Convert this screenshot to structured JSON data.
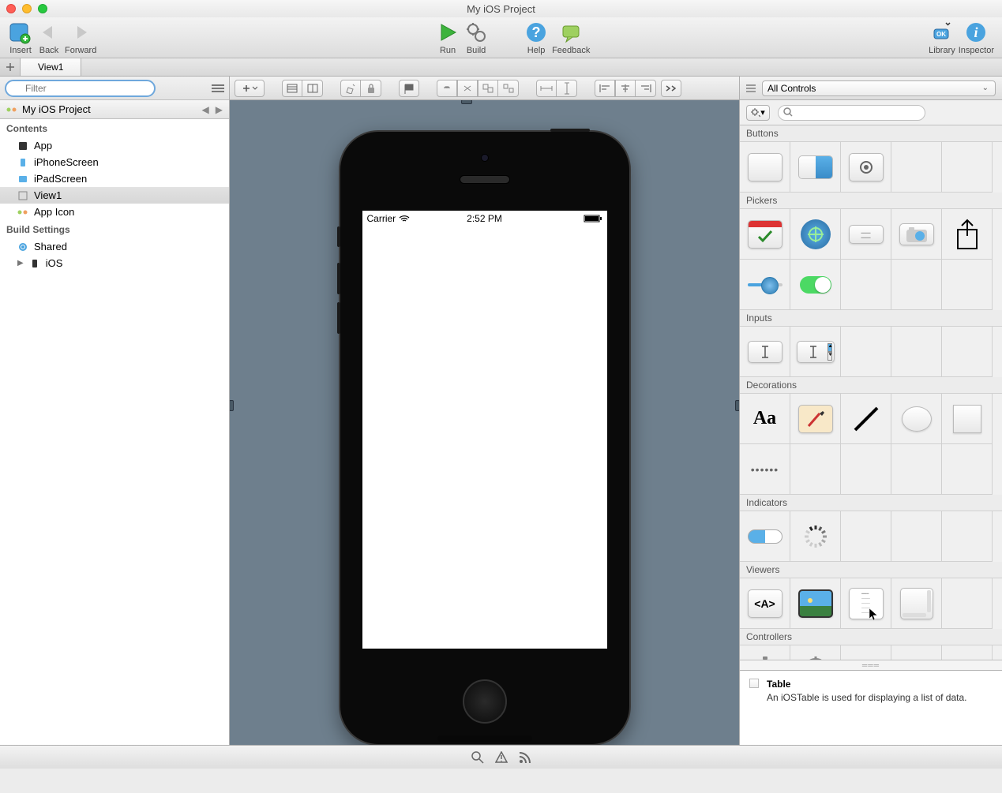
{
  "window": {
    "title": "My iOS Project"
  },
  "toolbar": {
    "insert": "Insert",
    "back": "Back",
    "forward": "Forward",
    "run": "Run",
    "build": "Build",
    "help": "Help",
    "feedback": "Feedback",
    "library": "Library",
    "inspector": "Inspector"
  },
  "tabs": [
    {
      "label": "View1"
    }
  ],
  "filter": {
    "placeholder": "Filter"
  },
  "project": {
    "name": "My iOS Project"
  },
  "contents": {
    "header": "Contents",
    "items": [
      {
        "label": "App"
      },
      {
        "label": "iPhoneScreen"
      },
      {
        "label": "iPadScreen"
      },
      {
        "label": "View1"
      },
      {
        "label": "App Icon"
      }
    ]
  },
  "buildSettings": {
    "header": "Build Settings",
    "items": [
      {
        "label": "Shared"
      },
      {
        "label": "iOS"
      }
    ]
  },
  "statusBar": {
    "carrier": "Carrier",
    "time": "2:52 PM"
  },
  "library": {
    "selectLabel": "All Controls",
    "sections": {
      "buttons": "Buttons",
      "pickers": "Pickers",
      "inputs": "Inputs",
      "decorations": "Decorations",
      "indicators": "Indicators",
      "viewers": "Viewers",
      "controllers": "Controllers"
    }
  },
  "detail": {
    "title": "Table",
    "description": "An iOSTable is used for displaying a list of data."
  }
}
